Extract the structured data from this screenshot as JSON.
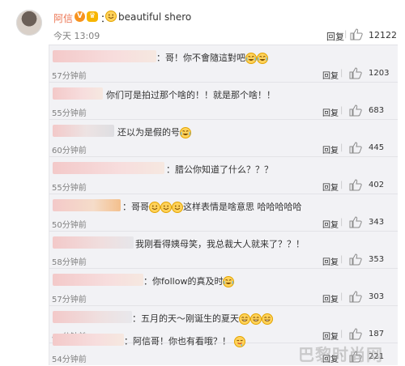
{
  "top": {
    "name": "阿信",
    "badge": "V",
    "colon": "：",
    "text": "beautiful shero",
    "time": "今天 13:09",
    "reply": "回复",
    "likes": "12122"
  },
  "comments": [
    {
      "text": "：哥！你不會隨這對吧",
      "time": "57分钟前",
      "reply": "回复",
      "likes": "1203"
    },
    {
      "text": "你们可是拍过那个啥的！！就是那个啥！！",
      "time": "55分钟前",
      "reply": "回复",
      "likes": "683"
    },
    {
      "text": "还以为是假的号",
      "time": "60分钟前",
      "reply": "回复",
      "likes": "445"
    },
    {
      "text": "：腊公你知道了什么？？？",
      "time": "55分钟前",
      "reply": "回复",
      "likes": "402"
    },
    {
      "text": "：哥哥",
      "text2": "这样表情是啥意思 哈哈哈哈哈",
      "time": "50分钟前",
      "reply": "回复",
      "likes": "343"
    },
    {
      "text": "我刚看得姨母笑，我总裁大人就来了？？！",
      "time": "58分钟前",
      "reply": "回复",
      "likes": "353"
    },
    {
      "text": "：你follow的真及时",
      "time": "57分钟前",
      "reply": "回复",
      "likes": "303"
    },
    {
      "text": "：五月的天～刚诞生的夏天",
      "time": "44分钟前",
      "reply": "回复",
      "likes": "187"
    },
    {
      "text": "：阿信哥！你也有看哦？！",
      "time": "54分钟前",
      "reply": "回复",
      "likes": "221"
    }
  ],
  "watermark": "巴黎时尚网",
  "colors": {
    "name": "#eb7350",
    "panel": "#f2f2f5",
    "time": "#808080"
  },
  "icons": [
    "avatar",
    "verified-badge",
    "crown-badge",
    "smile-emoji",
    "laugh-cry-emoji",
    "thumbs-up-icon"
  ]
}
